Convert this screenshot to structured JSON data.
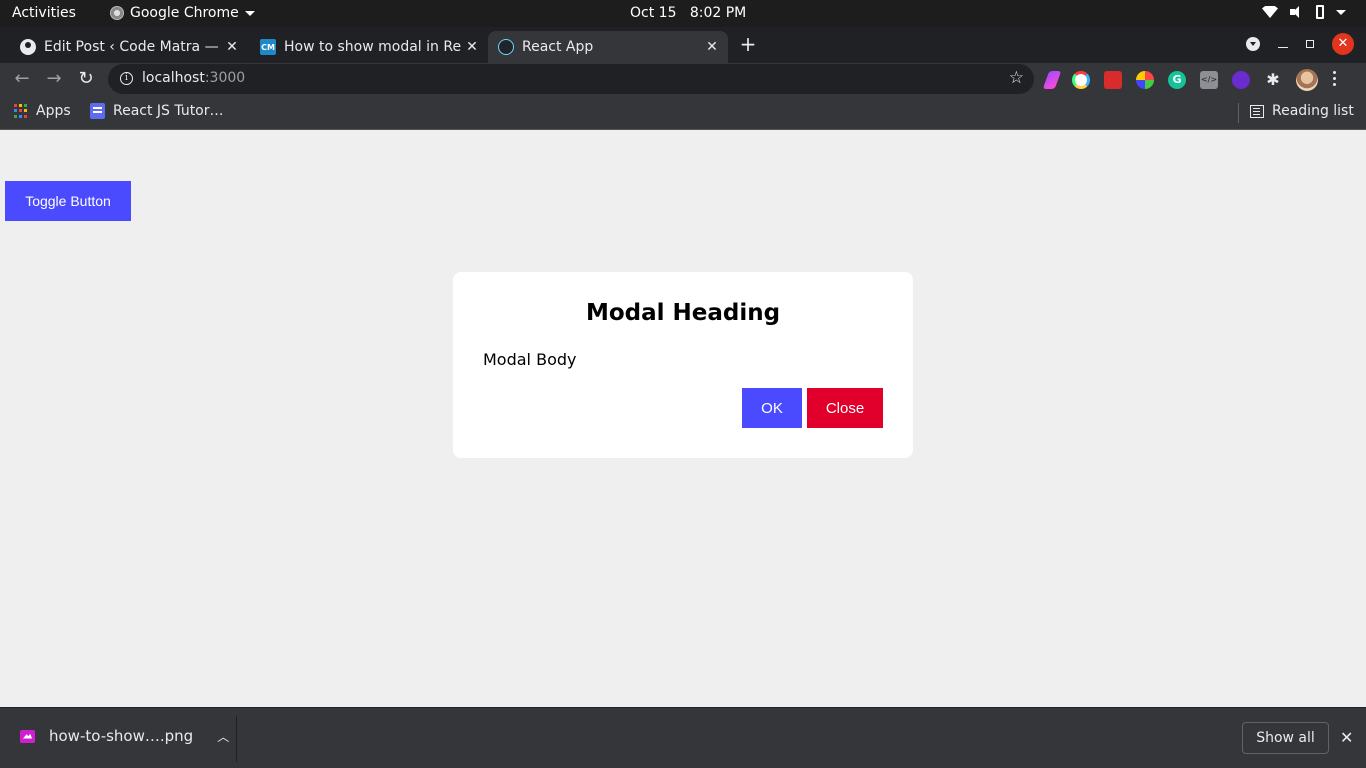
{
  "system": {
    "activities": "Activities",
    "app_name": "Google Chrome",
    "clock": "Oct 15   8:02 PM"
  },
  "tabs": [
    {
      "title": "Edit Post ‹ Code Matra — W",
      "favicon": "globe-icon",
      "active": false
    },
    {
      "title": "How to show modal in Rea",
      "favicon": "cm-icon",
      "active": false
    },
    {
      "title": "React App",
      "favicon": "react-icon",
      "active": true
    }
  ],
  "toolbar": {
    "url_host": "localhost",
    "url_port": ":3000"
  },
  "bookmarks": {
    "apps_label": "Apps",
    "bookmark1": "React JS Tutor…",
    "reading_list": "Reading list"
  },
  "page": {
    "toggle_button": "Toggle Button",
    "modal": {
      "heading": "Modal Heading",
      "body": "Modal Body",
      "ok_label": "OK",
      "close_label": "Close"
    }
  },
  "downloads": {
    "filename": "how-to-show….png",
    "show_all": "Show all"
  },
  "colors": {
    "primary_button": "#4a4aff",
    "danger_button": "#e0002b",
    "page_bg": "#efefef"
  }
}
